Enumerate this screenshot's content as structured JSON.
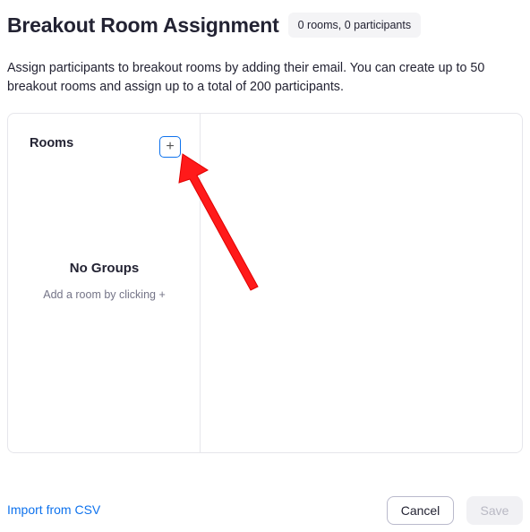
{
  "header": {
    "title": "Breakout Room Assignment",
    "count_badge": "0 rooms, 0 participants"
  },
  "description": "Assign participants to breakout rooms by adding their email. You can create up to 50 breakout rooms and assign up to a total of 200 participants.",
  "rooms_panel": {
    "label": "Rooms",
    "add_button_label": "+",
    "empty_title": "No Groups",
    "empty_hint": "Add a room by clicking +"
  },
  "footer": {
    "import_link": "Import from CSV",
    "cancel_label": "Cancel",
    "save_label": "Save"
  },
  "icons": {
    "add": "plus-icon",
    "annotation": "red-arrow-annotation"
  },
  "colors": {
    "accent": "#0e72ed",
    "annotation_arrow": "#ff0000",
    "disabled_bg": "#f1f1f4"
  }
}
